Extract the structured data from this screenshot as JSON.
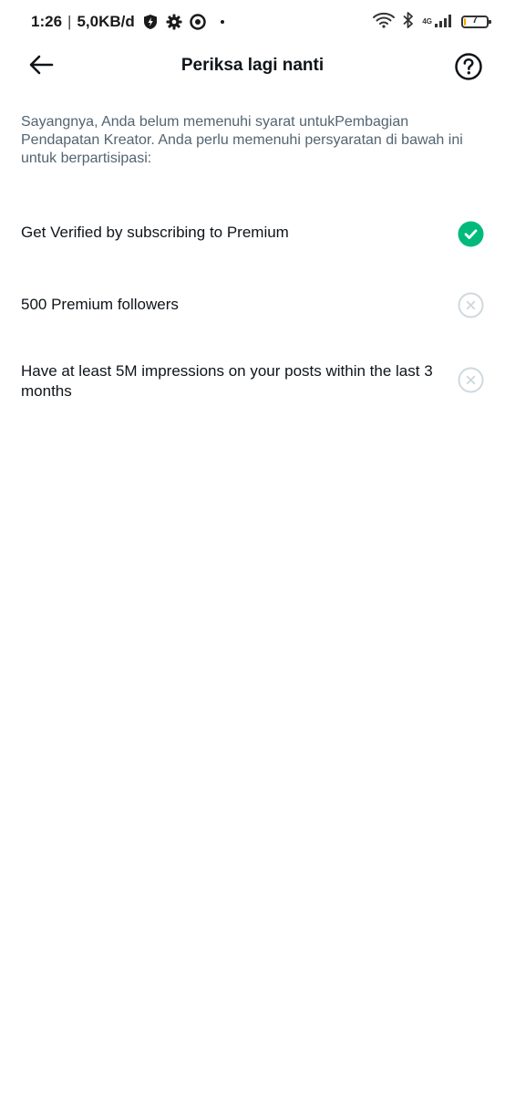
{
  "status_bar": {
    "time": "1:26",
    "separator": "|",
    "speed": "5,0KB/d",
    "network_type": "4G",
    "battery_level": "7",
    "battery_fraction": 0.07,
    "icons": [
      "shield-bolt-icon",
      "gear-icon",
      "target-icon",
      "notification-dot",
      "wifi-icon",
      "bluetooth-icon",
      "signal-icon",
      "battery-icon"
    ]
  },
  "header": {
    "title": "Periksa lagi nanti",
    "back_icon": "arrow-left-icon",
    "help_icon": "question-circle-icon"
  },
  "intro_text": "Sayangnya, Anda belum memenuhi syarat untukPembagian Pendapatan Kreator. Anda perlu memenuhi persyaratan di bawah ini untuk berpartisipasi:",
  "requirements": [
    {
      "label": "Get Verified by subscribing to Premium",
      "met": true,
      "icon": "check-circle-icon"
    },
    {
      "label": "500 Premium followers",
      "met": false,
      "icon": "x-circle-icon"
    },
    {
      "label": "Have at least 5M impressions on your posts within the last 3 months",
      "met": false,
      "icon": "x-circle-icon"
    }
  ],
  "colors": {
    "met": "#00ba7c",
    "unmet": "#cfd9de",
    "secondary_text": "#536471",
    "primary_text": "#0f1419"
  }
}
